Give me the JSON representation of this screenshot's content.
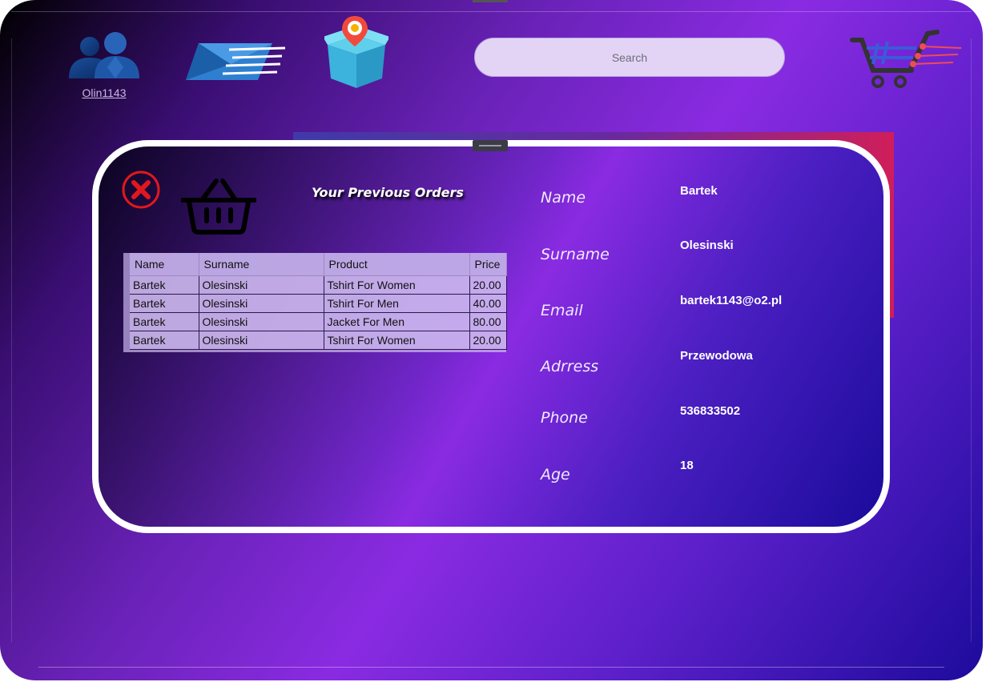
{
  "header": {
    "username": "Olin1143",
    "search_placeholder": "Search",
    "icons": [
      "users-icon",
      "mail-icon",
      "package-location-icon",
      "shopping-cart-icon"
    ]
  },
  "orders": {
    "title": "Your Previous Orders",
    "columns": [
      "Name",
      "Surname",
      "Product",
      "Price"
    ],
    "rows": [
      [
        "Bartek",
        "Olesinski",
        "Tshirt For Women",
        "20.00"
      ],
      [
        "Bartek",
        "Olesinski",
        "Tshirt For Men",
        "40.00"
      ],
      [
        "Bartek",
        "Olesinski",
        "Jacket For Men",
        "80.00"
      ],
      [
        "Bartek",
        "Olesinski",
        "Tshirt For Women",
        "20.00"
      ]
    ]
  },
  "profile": {
    "name_label": "Name",
    "name_value": "Bartek",
    "surname_label": "Surname",
    "surname_value": "Olesinski",
    "email_label": "Email",
    "email_value": "bartek1143@o2.pl",
    "address_label": "Adrress",
    "address_value": "Przewodowa",
    "phone_label": "Phone",
    "phone_value": "536833502",
    "age_label": "Age",
    "age_value": "18"
  },
  "colors": {
    "accent_close": "#e0181e",
    "search_bg": "#e3d4f5",
    "panel_border": "#ffffff"
  }
}
